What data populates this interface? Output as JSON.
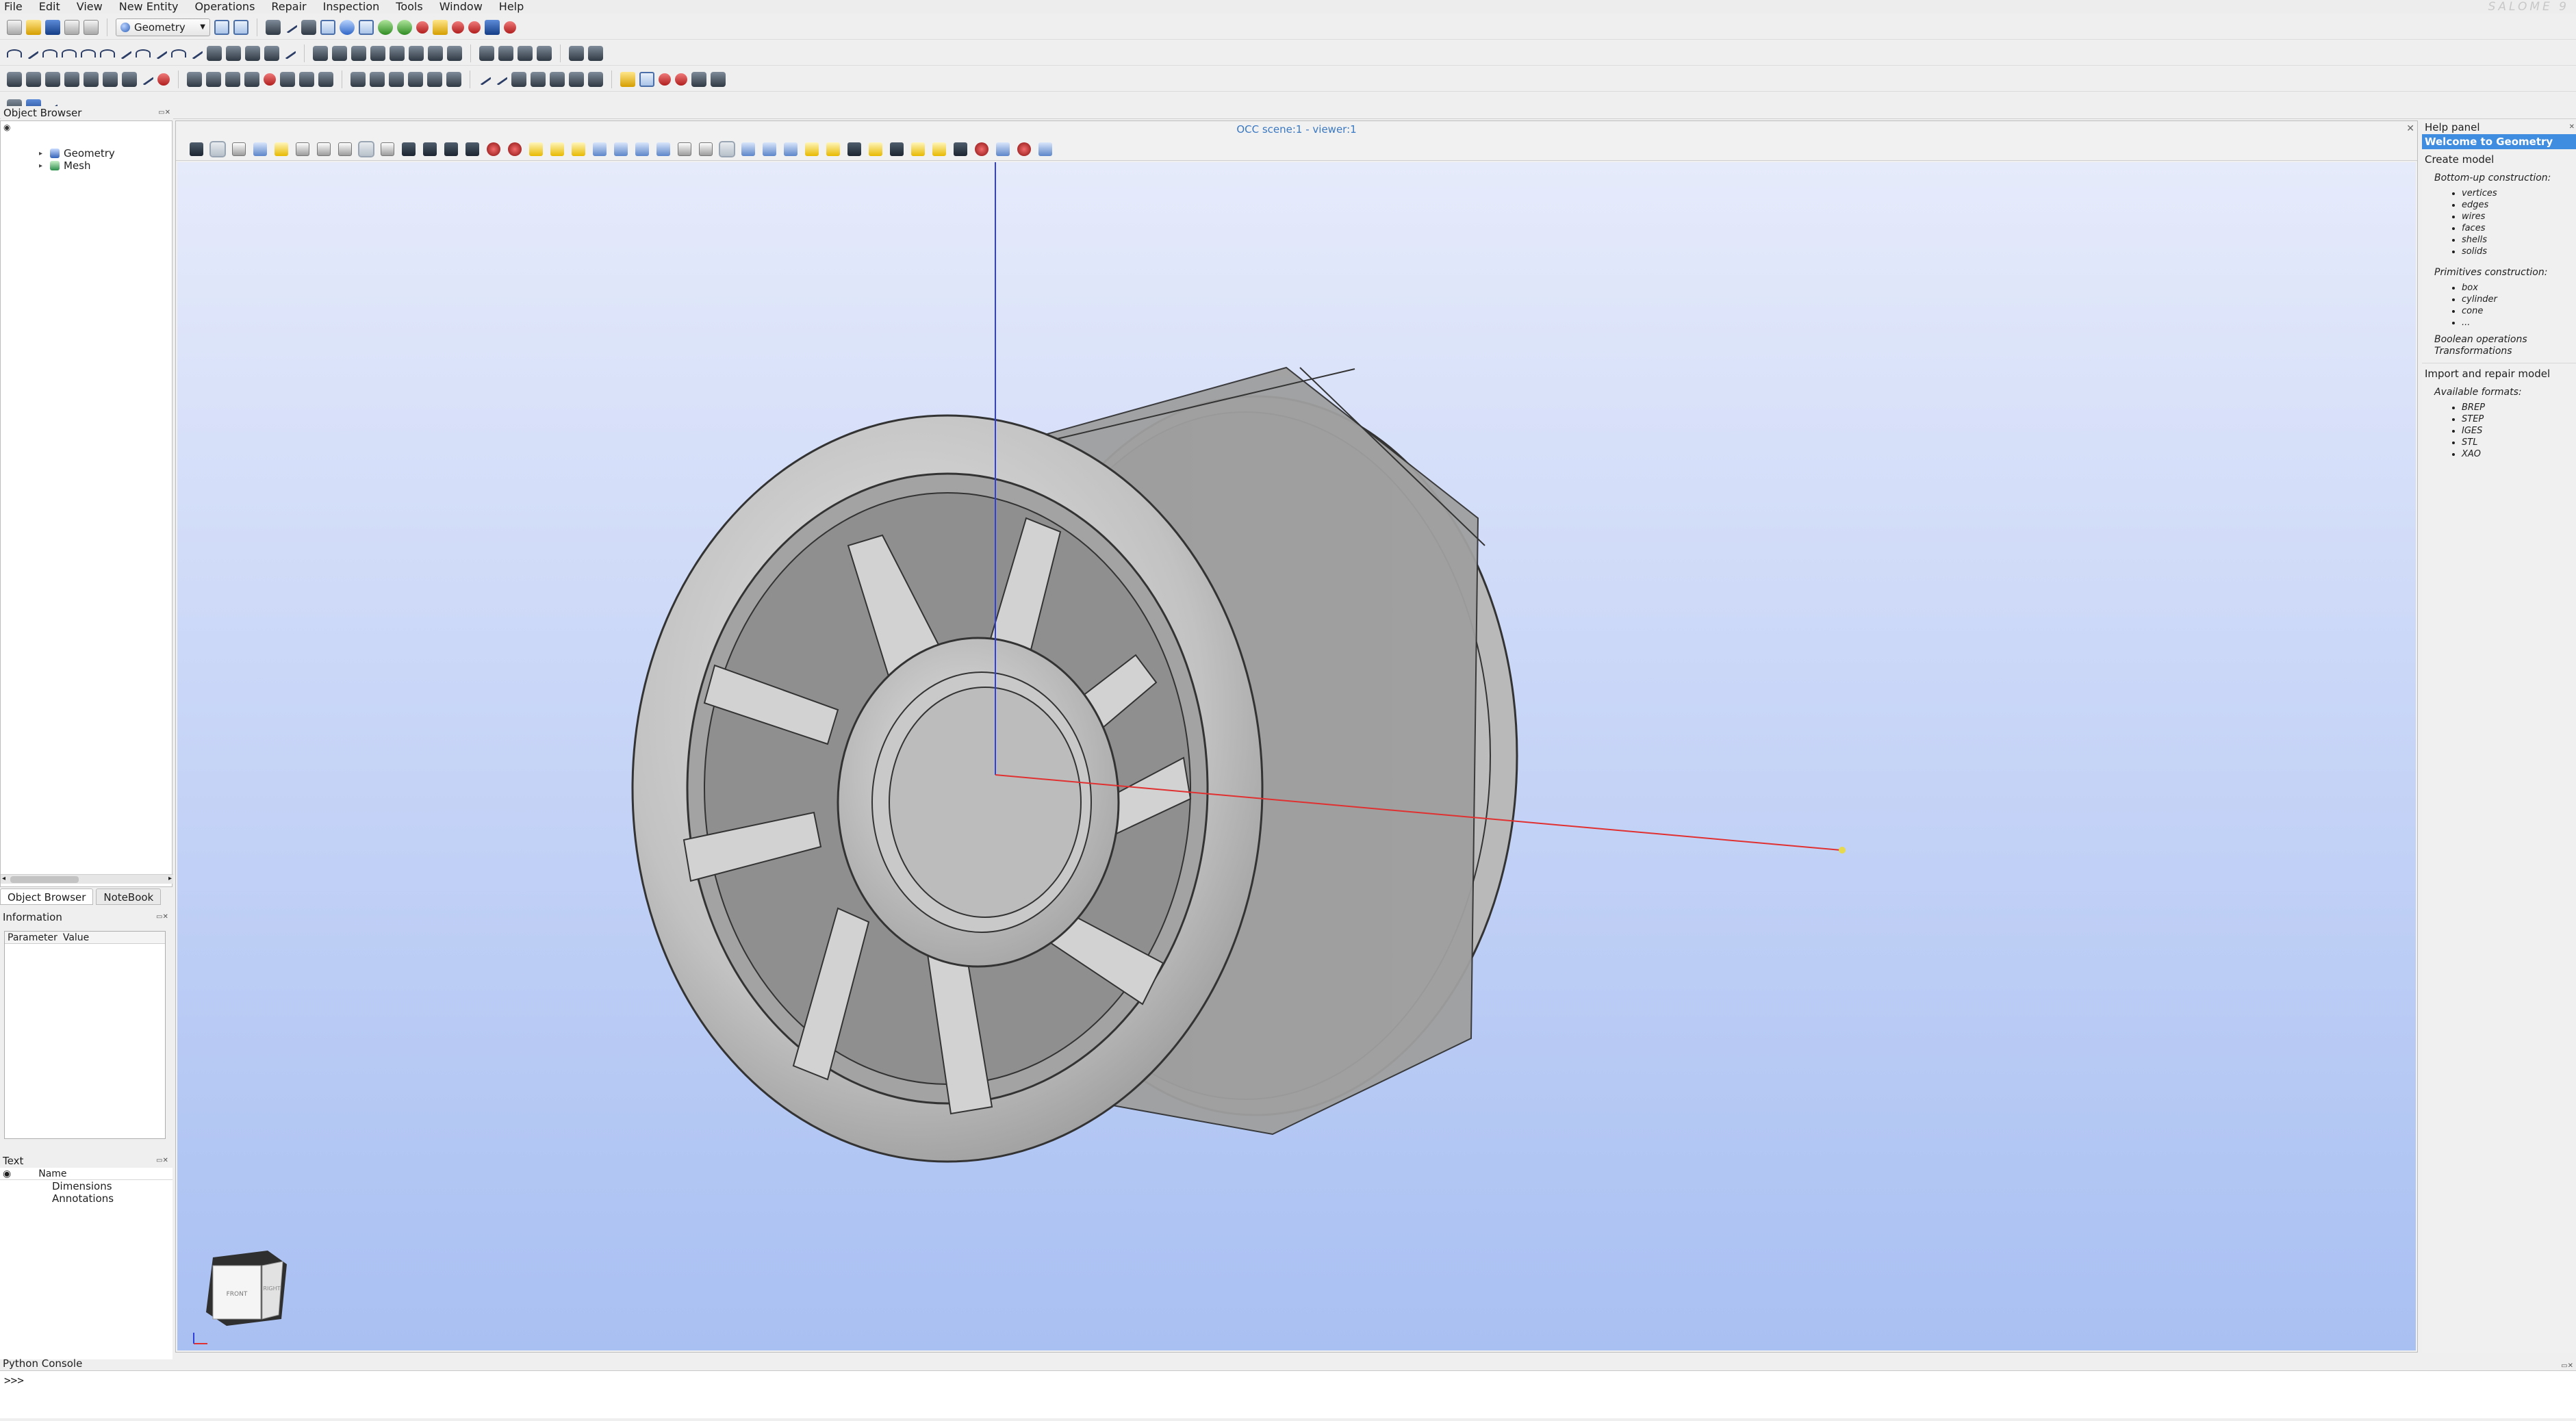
{
  "menubar": {
    "items": [
      "File",
      "Edit",
      "View",
      "New Entity",
      "Operations",
      "Repair",
      "Inspection",
      "Tools",
      "Window",
      "Help"
    ],
    "brand": "SALOME 9"
  },
  "toolbar": {
    "module_select": "Geometry"
  },
  "object_browser": {
    "title": "Object Browser",
    "tree": [
      "Geometry",
      "Mesh"
    ]
  },
  "tabs": [
    "Object Browser",
    "NoteBook"
  ],
  "information": {
    "title": "Information",
    "columns": [
      "Parameter",
      "Value"
    ]
  },
  "text_panel": {
    "title": "Text",
    "column": "Name",
    "rows": [
      "Dimensions",
      "Annotations"
    ]
  },
  "viewer": {
    "title": "OCC scene:1 - viewer:1"
  },
  "help": {
    "title": "Help panel",
    "welcome": "Welcome to Geometry",
    "create_model": "Create model",
    "bottom_up": "Bottom-up construction:",
    "bottom_up_items": [
      "vertices",
      "edges",
      "wires",
      "faces",
      "shells",
      "solids"
    ],
    "primitives": "Primitives construction:",
    "primitive_items": [
      "box",
      "cylinder",
      "cone",
      "..."
    ],
    "boolean": "Boolean operations",
    "transformations": "Transformations",
    "import_repair": "Import and repair model",
    "formats_label": "Available formats:",
    "formats": [
      "BREP",
      "STEP",
      "IGES",
      "STL",
      "XAO"
    ]
  },
  "console": {
    "title": "Python Console",
    "prompt": ">>>"
  },
  "viewcube": {
    "front": "FRONT",
    "right": "RIGHT"
  },
  "colors": {
    "accent": "#3e8de0",
    "axis_x": "#e03030",
    "axis_z": "#3040d8",
    "viewer_title": "#3a78c2"
  }
}
